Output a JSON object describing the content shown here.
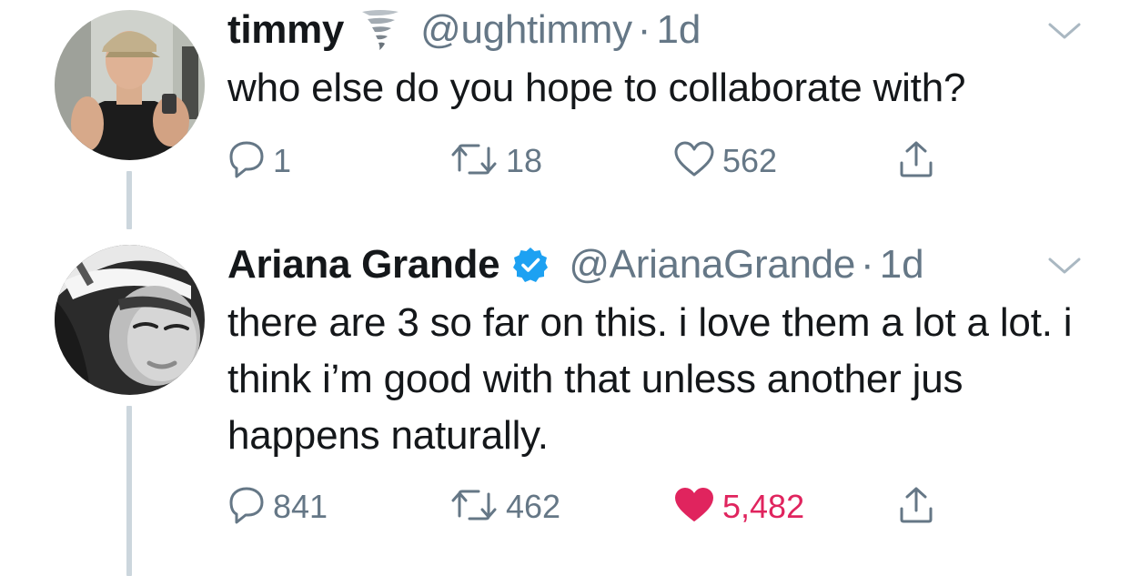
{
  "tweets": [
    {
      "display_name": "timmy",
      "name_emoji": "tornado-icon",
      "verified": false,
      "handle": "@ughtimmy",
      "separator": "·",
      "timestamp": "1d",
      "text": "who else do you hope to collaborate with?",
      "replies": "1",
      "retweets": "18",
      "likes": "562",
      "liked": false
    },
    {
      "display_name": "Ariana Grande",
      "verified": true,
      "handle": "@ArianaGrande",
      "separator": "·",
      "timestamp": "1d",
      "text": "there are 3 so far on this. i love them a lot a lot. i think i’m good with that unless another jus happens naturally.",
      "replies": "841",
      "retweets": "462",
      "likes": "5,482",
      "liked": true
    }
  ],
  "colors": {
    "text_primary": "#14171a",
    "text_secondary": "#657786",
    "like_active": "#e0245e",
    "verified_blue": "#1da1f2",
    "thread_line": "#ccd6dd"
  }
}
